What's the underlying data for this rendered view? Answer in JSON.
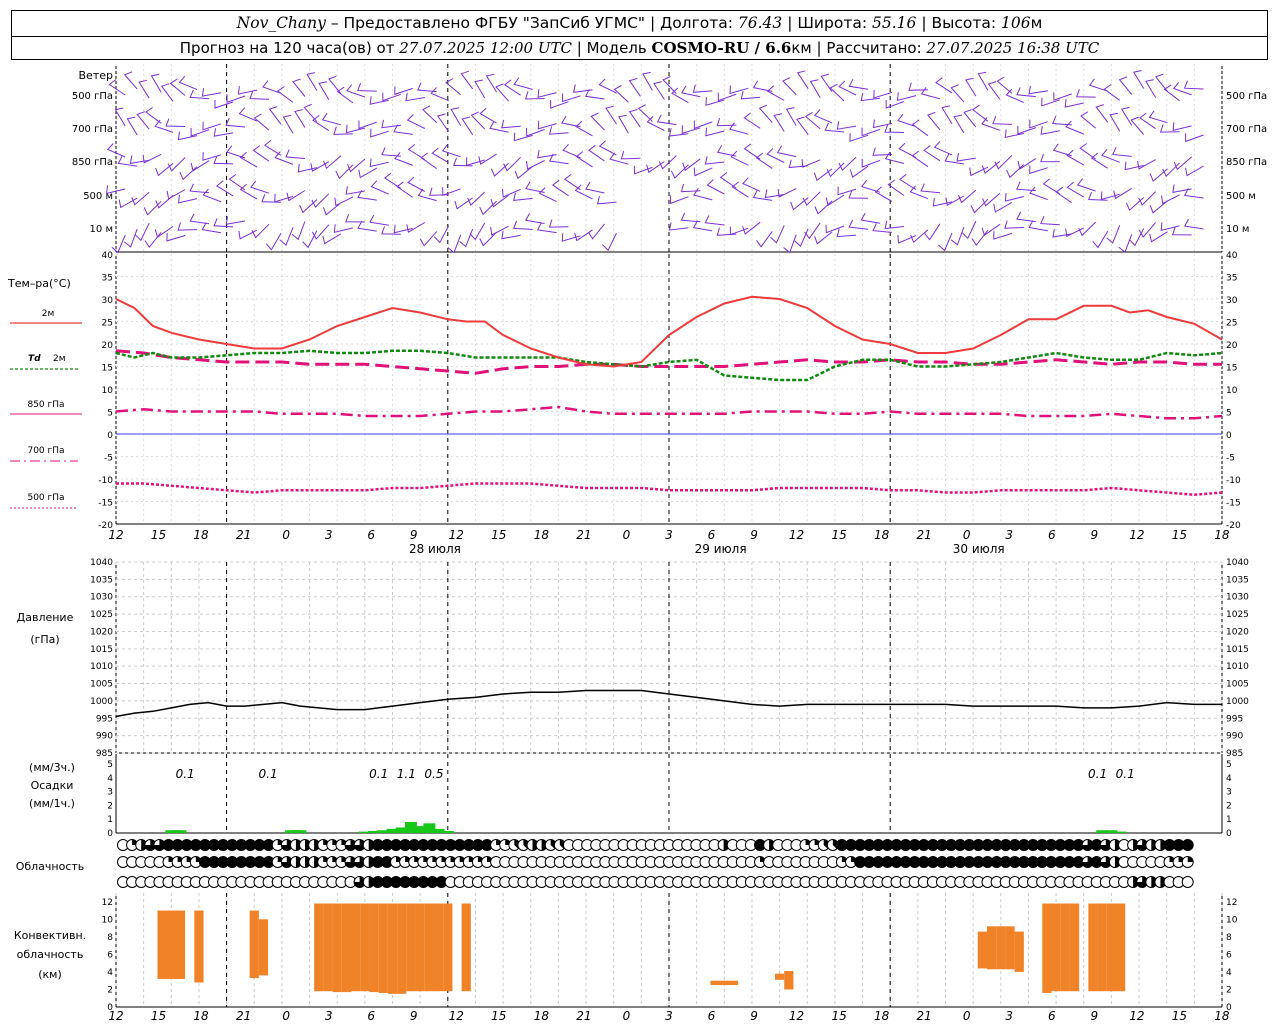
{
  "header": {
    "station": "Nov_Chany",
    "provider": " – Предоставлено ФГБУ \"ЗапСиб УГМС\" | Долгота: ",
    "longitude": "76.43",
    "lat_label": " | Широта: ",
    "latitude": "55.16",
    "alt_label": " | Высота: ",
    "altitude": "106",
    "alt_unit": "м",
    "forecast_prefix": "Прогноз на 120 часа(ов) от ",
    "forecast_time": "27.07.2025 12:00 UTC",
    "model_label": "  | Модель ",
    "model": "COSMO-RU / 6.6",
    "model_unit": "км",
    "calc_label": " | Рассчитано: ",
    "calc_time": "27.07.2025 16:38 UTC"
  },
  "labels": {
    "wind": "Ветер",
    "temp": "Тем–ра(°С)",
    "t2m": "2м",
    "td": "Td",
    "td_unit": "2м",
    "p850": "850 гПа",
    "p700": "700 гПа",
    "p500": "500 гПа",
    "pressure": "Давление",
    "pressure_unit": "(гПа)",
    "precip_unit3": "(мм/3ч.)",
    "precip": "Осадки",
    "precip_unit1": "(мм/1ч.)",
    "cloud": "Облачность",
    "conv1": "Конвективн.",
    "conv2": "облачность",
    "conv3": "(км)"
  },
  "colors": {
    "wind": "#7b2fd6",
    "t2m": "#ee3b3b",
    "td": "#108a10",
    "p850": "#e0127a",
    "p700": "#e0127a",
    "p500": "#e0127a",
    "zero": "#3d3df0",
    "pressure": "#000000",
    "precip": "#18c818",
    "conv": "#f08228"
  },
  "chart_data": [
    {
      "type": "wind_barbs",
      "levels": [
        "500 гПа",
        "700 гПа",
        "850 гПа",
        "500 м",
        "10 м"
      ],
      "x_hours": [
        0,
        120
      ]
    },
    {
      "type": "line",
      "title": "Тем–ра(°С)",
      "ylim": [
        -20,
        40
      ],
      "yticks": [
        40,
        35,
        30,
        25,
        20,
        15,
        10,
        5,
        0,
        -5,
        -10,
        -15,
        -20
      ],
      "xticks": [
        "12",
        "15",
        "18",
        "21",
        "0",
        "3",
        "6",
        "9",
        "12",
        "15",
        "18",
        "21",
        "0",
        "3",
        "6",
        "9",
        "12",
        "15",
        "18",
        "21",
        "0",
        "3",
        "6",
        "9",
        "12",
        "15",
        "18"
      ],
      "dates": [
        "28 июля",
        "29 июля",
        "30 июля"
      ],
      "series": [
        {
          "name": "2м",
          "x": [
            0,
            2,
            4,
            6,
            9,
            12,
            15,
            18,
            21,
            24,
            27,
            30,
            33,
            36,
            38,
            40,
            42,
            45,
            48,
            51,
            54,
            57,
            60,
            63,
            66,
            69,
            72,
            75,
            78,
            81,
            84,
            87,
            90,
            93,
            96,
            99,
            102,
            105,
            108,
            110,
            112,
            114,
            117,
            120
          ],
          "values": [
            30,
            28,
            24,
            22.5,
            21,
            20,
            19,
            19,
            21,
            24,
            26,
            28,
            27,
            25.5,
            25,
            25,
            22,
            19,
            17,
            15.5,
            15,
            16,
            22,
            26,
            29,
            30.5,
            30,
            28,
            24,
            21,
            20,
            18,
            18,
            19,
            22,
            25.5,
            25.5,
            28.5,
            28.5,
            27,
            27.5,
            26,
            24.5,
            21
          ]
        },
        {
          "name": "Td 2м",
          "x": [
            0,
            2,
            4,
            6,
            9,
            12,
            15,
            18,
            21,
            24,
            27,
            30,
            33,
            36,
            39,
            42,
            45,
            48,
            51,
            54,
            57,
            60,
            63,
            66,
            69,
            72,
            75,
            78,
            81,
            84,
            87,
            90,
            93,
            96,
            99,
            102,
            105,
            108,
            111,
            114,
            117,
            120
          ],
          "values": [
            18,
            17,
            18,
            17,
            17,
            17.5,
            18,
            18,
            18.5,
            18,
            18,
            18.5,
            18.5,
            18,
            17,
            17,
            17,
            17,
            16,
            15.5,
            15,
            16,
            16.5,
            13,
            12.5,
            12,
            12,
            15,
            16.5,
            16.5,
            15,
            15,
            15.5,
            16,
            17,
            18,
            17,
            16.5,
            16.5,
            18,
            17.5,
            18
          ]
        },
        {
          "name": "850 гПа",
          "x": [
            0,
            3,
            6,
            9,
            12,
            15,
            18,
            21,
            24,
            27,
            30,
            33,
            36,
            39,
            42,
            45,
            48,
            51,
            54,
            57,
            60,
            63,
            66,
            69,
            72,
            75,
            78,
            81,
            84,
            87,
            90,
            93,
            96,
            99,
            102,
            105,
            108,
            111,
            114,
            117,
            120
          ],
          "values": [
            18.5,
            18,
            17,
            16.5,
            16,
            16,
            16,
            15.5,
            15.5,
            15.5,
            15,
            14.5,
            14,
            13.5,
            14.5,
            15,
            15,
            15.5,
            15.5,
            15,
            15,
            15,
            15,
            15.5,
            16,
            16.5,
            16,
            16,
            16.5,
            16,
            16,
            15.5,
            15.5,
            16,
            16.5,
            16,
            15.5,
            16,
            16,
            15.5,
            15.5
          ]
        },
        {
          "name": "700 гПа",
          "x": [
            0,
            3,
            6,
            9,
            12,
            15,
            18,
            21,
            24,
            27,
            30,
            33,
            36,
            39,
            42,
            45,
            48,
            51,
            54,
            57,
            60,
            63,
            66,
            69,
            72,
            75,
            78,
            81,
            84,
            87,
            90,
            93,
            96,
            99,
            102,
            105,
            108,
            111,
            114,
            117,
            120
          ],
          "values": [
            5,
            5.5,
            5,
            5,
            5,
            5,
            4.5,
            4.5,
            4.5,
            4,
            4,
            4,
            4.5,
            5,
            5,
            5.5,
            6,
            5,
            4.5,
            4.5,
            4.5,
            4.5,
            4.5,
            5,
            5,
            5,
            4.5,
            4.5,
            5,
            4.5,
            4.5,
            4.5,
            4.5,
            4,
            4,
            4,
            4.5,
            4,
            3.5,
            3.5,
            4
          ]
        },
        {
          "name": "500 гПа",
          "x": [
            0,
            3,
            6,
            9,
            12,
            15,
            18,
            21,
            24,
            27,
            30,
            33,
            36,
            39,
            42,
            45,
            48,
            51,
            54,
            57,
            60,
            63,
            66,
            69,
            72,
            75,
            78,
            81,
            84,
            87,
            90,
            93,
            96,
            99,
            102,
            105,
            108,
            111,
            114,
            117,
            120
          ],
          "values": [
            -11,
            -11,
            -11.5,
            -12,
            -12.5,
            -13,
            -12.5,
            -12.5,
            -12.5,
            -12.5,
            -12,
            -12,
            -11.5,
            -11,
            -11,
            -11,
            -11.5,
            -12,
            -12,
            -12,
            -12.5,
            -12.5,
            -12.5,
            -12.5,
            -12,
            -12,
            -12,
            -12,
            -12.5,
            -12.5,
            -13,
            -13,
            -12.5,
            -12.5,
            -12.5,
            -12.5,
            -12,
            -12.5,
            -13,
            -13.5,
            -13
          ]
        }
      ]
    },
    {
      "type": "line",
      "title": "Давление",
      "ylabel": "(гПа)",
      "ylim": [
        985,
        1040
      ],
      "yticks": [
        1040,
        1035,
        1030,
        1025,
        1020,
        1015,
        1010,
        1005,
        1000,
        995,
        990,
        985
      ],
      "series": [
        {
          "name": "Давление",
          "x": [
            0,
            2,
            4,
            6,
            8,
            10,
            12,
            14,
            16,
            18,
            20,
            22,
            24,
            27,
            30,
            33,
            36,
            39,
            42,
            45,
            48,
            51,
            54,
            57,
            60,
            63,
            66,
            69,
            72,
            75,
            78,
            81,
            84,
            87,
            90,
            93,
            96,
            99,
            102,
            105,
            108,
            111,
            114,
            117,
            120
          ],
          "values": [
            995.5,
            996.5,
            997,
            998,
            999,
            999.5,
            998.5,
            998.5,
            999,
            999.5,
            998.5,
            998,
            997.5,
            997.5,
            998.5,
            999.5,
            1000.5,
            1001,
            1002,
            1002.5,
            1002.5,
            1003,
            1003,
            1003,
            1002,
            1001,
            1000,
            999,
            998.5,
            999,
            999,
            999,
            999,
            999,
            999,
            998.5,
            998.5,
            998.5,
            998.5,
            998,
            998,
            998.5,
            999.5,
            999,
            999
          ]
        }
      ]
    },
    {
      "type": "bar",
      "title": "Осадки",
      "ylabel": "(мм/1ч.)",
      "ylim": [
        0,
        5
      ],
      "yticks": [
        5,
        4,
        3,
        2,
        1,
        0
      ],
      "x": [
        6,
        6.5,
        7,
        19,
        19.5,
        20,
        27,
        28,
        29,
        30,
        31,
        32,
        33,
        34,
        35,
        36,
        107,
        108,
        109
      ],
      "values": [
        0.2,
        0.2,
        0.2,
        0.2,
        0.2,
        0.2,
        0.1,
        0.15,
        0.2,
        0.3,
        0.4,
        0.8,
        0.5,
        0.7,
        0.3,
        0.15,
        0.2,
        0.2,
        0.1
      ],
      "totals_3h": [
        {
          "x": 7.5,
          "label": "0.1"
        },
        {
          "x": 16.5,
          "label": "0.1"
        },
        {
          "x": 28.5,
          "label": "0.1"
        },
        {
          "x": 31.5,
          "label": "1.1"
        },
        {
          "x": 34.5,
          "label": "0.5"
        },
        {
          "x": 106.5,
          "label": "0.1"
        },
        {
          "x": 109.5,
          "label": "0.1"
        }
      ]
    },
    {
      "type": "cloud_cover",
      "title": "Облачность",
      "rows": [
        "0246688888888888826444222664888888888888822334433000000000000000004000840002233888888888888888888888888888686404644888"
      ]
    },
    {
      "type": "bar",
      "title": "Конвективн. облачность",
      "ylabel": "(км)",
      "ylim": [
        0,
        13
      ],
      "yticks": [
        12,
        10,
        8,
        6,
        4,
        2,
        0
      ],
      "bars": [
        {
          "x0": 4.5,
          "x1": 7.5,
          "bottom": 3.2,
          "top": 11.0
        },
        {
          "x0": 8.5,
          "x1": 9.5,
          "bottom": 2.8,
          "top": 11.0
        },
        {
          "x0": 14.5,
          "x1": 15.5,
          "bottom": 3.3,
          "top": 11.0
        },
        {
          "x0": 15.5,
          "x1": 16.5,
          "bottom": 3.6,
          "top": 10.0
        },
        {
          "x0": 21.5,
          "x1": 22.5,
          "bottom": 1.8,
          "top": 11.8
        },
        {
          "x0": 22.5,
          "x1": 23.5,
          "bottom": 1.8,
          "top": 11.8
        },
        {
          "x0": 23.5,
          "x1": 24.5,
          "bottom": 1.7,
          "top": 11.8
        },
        {
          "x0": 24.5,
          "x1": 25.5,
          "bottom": 1.7,
          "top": 11.8
        },
        {
          "x0": 25.5,
          "x1": 26.5,
          "bottom": 1.8,
          "top": 11.8
        },
        {
          "x0": 26.5,
          "x1": 27.5,
          "bottom": 1.8,
          "top": 11.8
        },
        {
          "x0": 27.5,
          "x1": 28.5,
          "bottom": 1.7,
          "top": 11.8
        },
        {
          "x0": 28.5,
          "x1": 29.5,
          "bottom": 1.6,
          "top": 11.8
        },
        {
          "x0": 29.5,
          "x1": 30.5,
          "bottom": 1.5,
          "top": 11.8
        },
        {
          "x0": 30.5,
          "x1": 31.5,
          "bottom": 1.5,
          "top": 11.8
        },
        {
          "x0": 31.5,
          "x1": 32.5,
          "bottom": 1.8,
          "top": 11.8
        },
        {
          "x0": 32.5,
          "x1": 33.5,
          "bottom": 1.8,
          "top": 11.8
        },
        {
          "x0": 33.5,
          "x1": 34.5,
          "bottom": 1.8,
          "top": 11.8
        },
        {
          "x0": 34.5,
          "x1": 35.5,
          "bottom": 1.8,
          "top": 11.8
        },
        {
          "x0": 35.5,
          "x1": 36.5,
          "bottom": 1.8,
          "top": 11.8
        },
        {
          "x0": 37.5,
          "x1": 38.5,
          "bottom": 1.8,
          "top": 11.8
        },
        {
          "x0": 64.5,
          "x1": 67.5,
          "bottom": 2.5,
          "top": 3.0
        },
        {
          "x0": 71.5,
          "x1": 72.5,
          "bottom": 3.1,
          "top": 3.8
        },
        {
          "x0": 72.5,
          "x1": 73.5,
          "bottom": 2.0,
          "top": 4.1
        },
        {
          "x0": 93.5,
          "x1": 94.5,
          "bottom": 4.4,
          "top": 8.6
        },
        {
          "x0": 94.5,
          "x1": 95.5,
          "bottom": 4.3,
          "top": 9.2
        },
        {
          "x0": 95.5,
          "x1": 96.5,
          "bottom": 4.3,
          "top": 9.2
        },
        {
          "x0": 96.5,
          "x1": 97.5,
          "bottom": 4.3,
          "top": 9.2
        },
        {
          "x0": 97.5,
          "x1": 98.5,
          "bottom": 4.0,
          "top": 8.6
        },
        {
          "x0": 100.5,
          "x1": 101.5,
          "bottom": 1.6,
          "top": 11.8
        },
        {
          "x0": 101.5,
          "x1": 102.5,
          "bottom": 1.8,
          "top": 11.8
        },
        {
          "x0": 102.5,
          "x1": 103.5,
          "bottom": 1.8,
          "top": 11.8
        },
        {
          "x0": 103.5,
          "x1": 104.5,
          "bottom": 1.8,
          "top": 11.8
        },
        {
          "x0": 105.5,
          "x1": 106.5,
          "bottom": 1.8,
          "top": 11.8
        },
        {
          "x0": 106.5,
          "x1": 107.5,
          "bottom": 1.8,
          "top": 11.8
        },
        {
          "x0": 107.5,
          "x1": 108.5,
          "bottom": 1.8,
          "top": 11.8
        },
        {
          "x0": 108.5,
          "x1": 109.5,
          "bottom": 1.8,
          "top": 11.8
        }
      ]
    }
  ]
}
